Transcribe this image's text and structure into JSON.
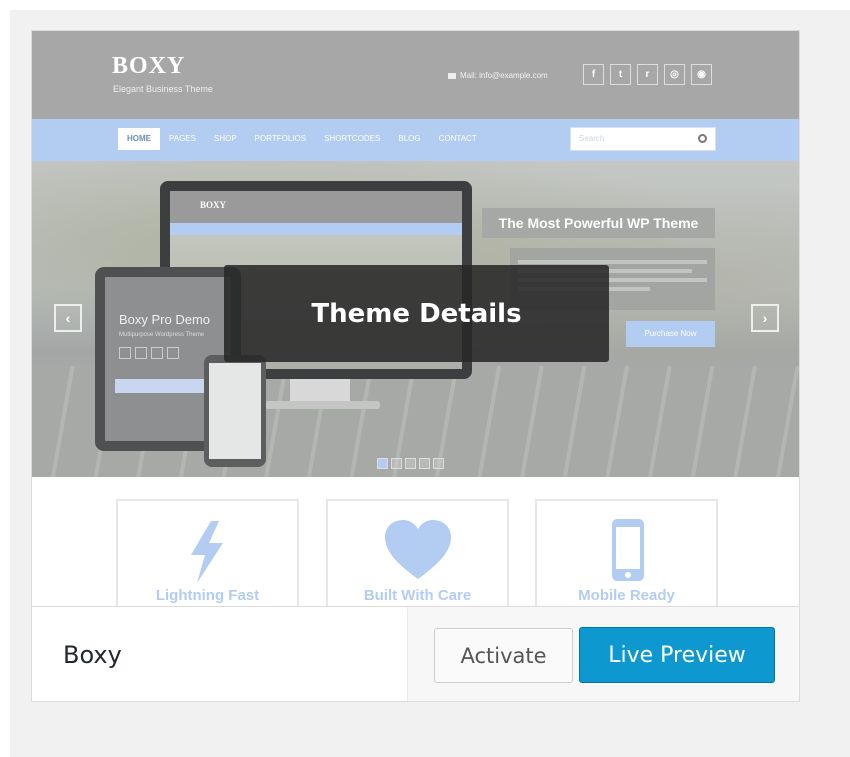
{
  "preview": {
    "site_logo": "BOXY",
    "site_tagline": "Elegant Business Theme",
    "mail_text": "Mail: info@example.com",
    "social_icons": [
      "facebook-icon",
      "twitter-icon",
      "rss-icon",
      "dribbble-icon",
      "pinterest-icon"
    ],
    "social_glyphs": [
      "f",
      "t",
      "r",
      "◎",
      "◉"
    ],
    "nav_items": [
      "HOME",
      "PAGES",
      "SHOP",
      "PORTFOLIOS",
      "SHORTCODES",
      "BLOG",
      "CONTACT"
    ],
    "search_placeholder": "Search",
    "hero": {
      "title": "The Most Powerful WP Theme",
      "button": "Purchase Now",
      "tablet_title": "Boxy Pro Demo",
      "tablet_subtitle": "Multipurpose Wordpress Theme",
      "monitor_logo": "BOXY",
      "slides": 5,
      "active_slide": 1
    },
    "features": [
      {
        "label": "Lightning Fast",
        "icon": "lightning-icon"
      },
      {
        "label": "Built With Care",
        "icon": "heart-icon"
      },
      {
        "label": "Mobile Ready",
        "icon": "mobile-icon"
      }
    ]
  },
  "overlay": {
    "label": "Theme Details"
  },
  "footer": {
    "theme_name": "Boxy",
    "activate_label": "Activate",
    "preview_label": "Live Preview"
  },
  "colors": {
    "accent": "#0d99cf",
    "nav": "#b3ccf1",
    "overlay": "#282828"
  }
}
